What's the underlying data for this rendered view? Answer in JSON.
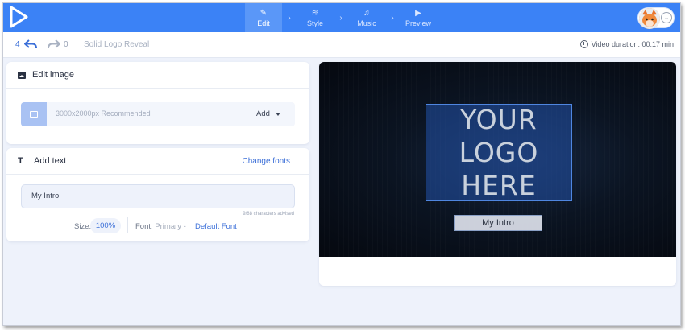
{
  "nav": {
    "steps": [
      {
        "label": "Edit",
        "icon": "pencil-icon"
      },
      {
        "label": "Style",
        "icon": "layers-icon"
      },
      {
        "label": "Music",
        "icon": "music-note-icon"
      },
      {
        "label": "Preview",
        "icon": "play-icon"
      }
    ],
    "active_step": "Edit",
    "accent_color": "#3b82f6"
  },
  "toolbar": {
    "undo_count": "4",
    "redo_count": "0",
    "project_name": "Solid Logo Reveal",
    "duration": "Video duration: 00:17 min"
  },
  "edit_image": {
    "title": "Edit image",
    "hint": "3000x2000px Recommended",
    "add_label": "Add"
  },
  "add_text": {
    "title": "Add text",
    "change_fonts": "Change fonts",
    "value": "My  Intro",
    "char_hint": "9/88 characters advised",
    "size_label": "Size:",
    "size_value": "100%",
    "font_label": "Font:",
    "font_primary": "Primary -",
    "font_default": "Default Font"
  },
  "preview": {
    "logo_lines": [
      "YOUR",
      "LOGO",
      "HERE"
    ],
    "intro_text": "My Intro"
  }
}
